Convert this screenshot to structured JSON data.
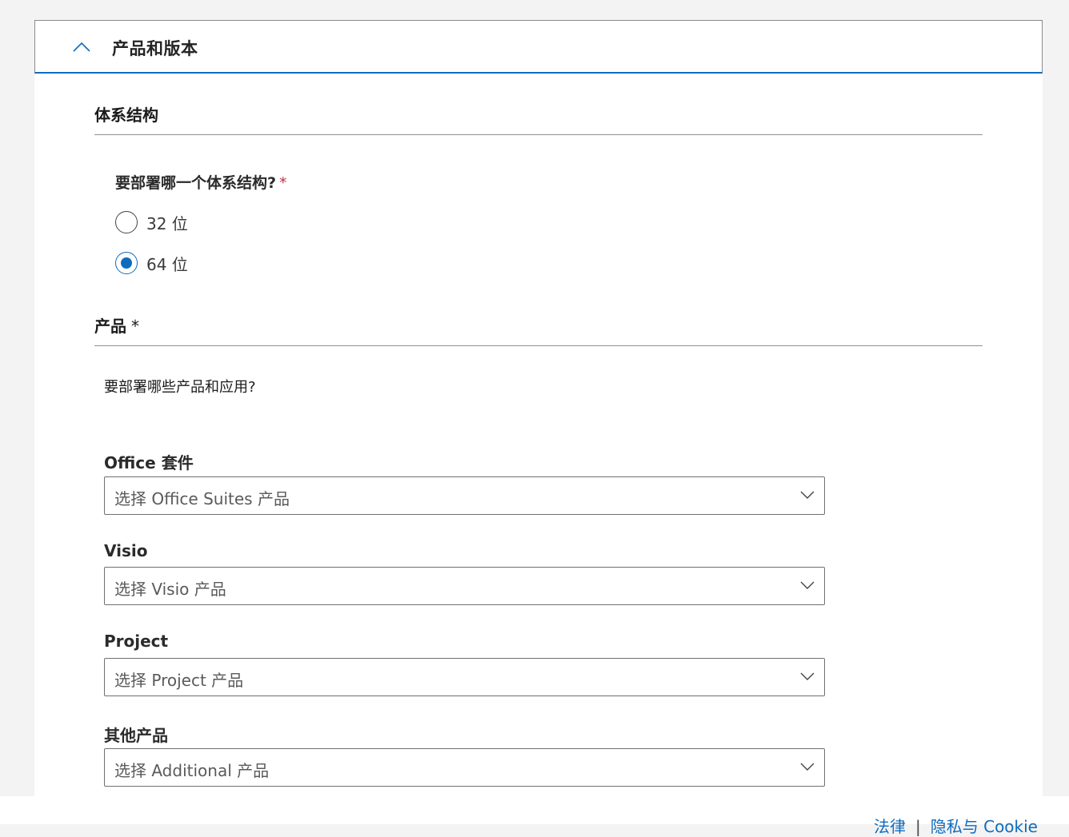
{
  "header": {
    "title": "产品和版本"
  },
  "architecture": {
    "section_title": "体系结构",
    "question": "要部署哪一个体系结构?",
    "required_mark": "*",
    "options": [
      {
        "label": "32 位",
        "selected": false
      },
      {
        "label": "64 位",
        "selected": true
      }
    ]
  },
  "products": {
    "section_title": "产品",
    "required_mark": "*",
    "description": "要部署哪些产品和应用?",
    "fields": [
      {
        "label": "Office 套件",
        "placeholder": "选择 Office Suites 产品"
      },
      {
        "label": "Visio",
        "placeholder": "选择 Visio 产品"
      },
      {
        "label": "Project",
        "placeholder": "选择 Project 产品"
      },
      {
        "label": "其他产品",
        "placeholder": "选择 Additional 产品"
      }
    ]
  },
  "footer": {
    "link_legal": "法律",
    "separator": "|",
    "link_privacy": "隐私与 Cookie"
  },
  "colors": {
    "accent": "#0f6cbd",
    "required": "#c4314b",
    "background": "#f3f3f3"
  }
}
